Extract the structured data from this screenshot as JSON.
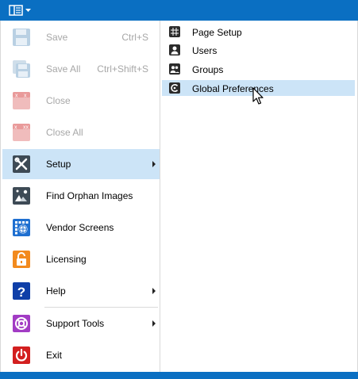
{
  "menu": {
    "items": [
      {
        "label": "Save",
        "shortcut": "Ctrl+S",
        "icon": "save-icon",
        "disabled": true
      },
      {
        "label": "Save All",
        "shortcut": "Ctrl+Shift+S",
        "icon": "save-all-icon",
        "disabled": true
      },
      {
        "label": "Close",
        "shortcut": "",
        "icon": "close-document-icon",
        "disabled": true
      },
      {
        "label": "Close All",
        "shortcut": "",
        "icon": "close-all-icon",
        "disabled": true
      },
      {
        "label": "Setup",
        "shortcut": "",
        "icon": "tools-icon",
        "disabled": false,
        "selected": true,
        "submenu": true
      },
      {
        "label": "Find Orphan Images",
        "shortcut": "",
        "icon": "find-images-icon",
        "disabled": false
      },
      {
        "label": "Vendor Screens",
        "shortcut": "",
        "icon": "vendor-grid-icon",
        "disabled": false
      },
      {
        "label": "Licensing",
        "shortcut": "",
        "icon": "lock-icon",
        "disabled": false
      },
      {
        "label": "Help",
        "shortcut": "",
        "icon": "help-icon",
        "disabled": false,
        "submenu": true
      },
      {
        "label": "Support Tools",
        "shortcut": "",
        "icon": "lifebuoy-icon",
        "disabled": false,
        "submenu": true
      },
      {
        "label": "Exit",
        "shortcut": "",
        "icon": "power-icon",
        "disabled": false
      }
    ]
  },
  "submenu": {
    "items": [
      {
        "label": "Page Setup",
        "icon": "page-setup-icon"
      },
      {
        "label": "Users",
        "icon": "user-icon"
      },
      {
        "label": "Groups",
        "icon": "group-icon"
      },
      {
        "label": "Global Preferences",
        "icon": "global-preferences-icon",
        "selected": true
      }
    ]
  },
  "colors": {
    "titlebar": "#0a6fc2",
    "selection": "#cce4f7",
    "disabled_text": "#a7a7a7"
  }
}
